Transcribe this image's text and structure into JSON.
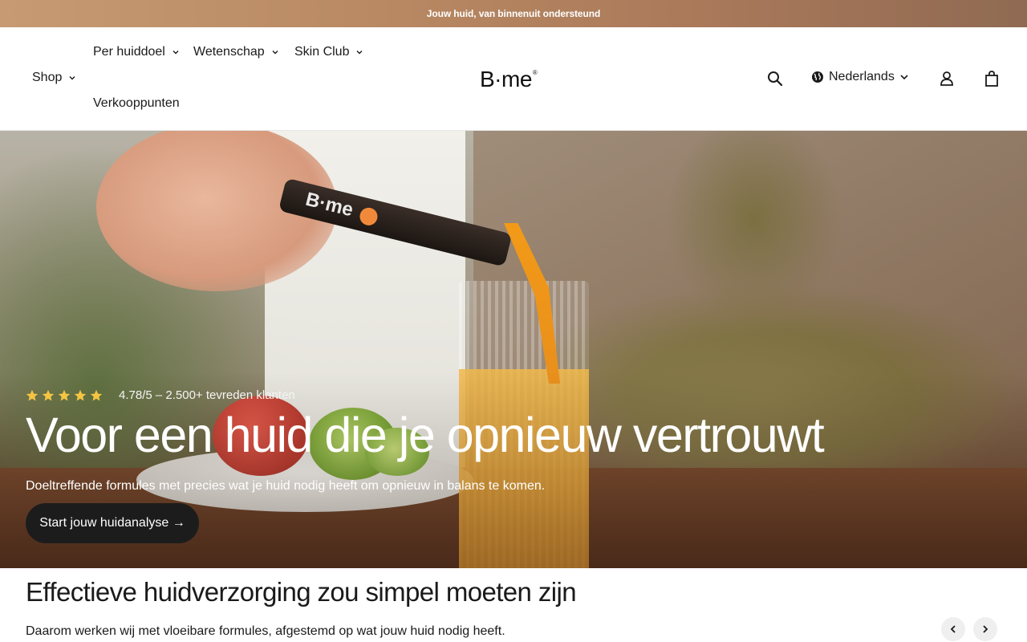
{
  "announcement": {
    "text": "Jouw huid, van binnenuit ondersteund"
  },
  "nav": {
    "shop": "Shop",
    "per_huiddoel": "Per huiddoel",
    "wetenschap": "Wetenschap",
    "skin_club": "Skin Club",
    "verkooppunten": "Verkooppunten"
  },
  "logo": {
    "text": "B·me",
    "reg": "®"
  },
  "header": {
    "language": "Nederlands"
  },
  "hero": {
    "vial_brand": "B·me",
    "rating_value": 5,
    "rating_text": "4.78/5 – 2.500+ tevreden klanten",
    "title": "Voor een huid die je opnieuw vertrouwt",
    "subtitle": "Doeltreffende formules met precies wat je huid nodig heeft om opnieuw in balans te komen.",
    "cta": "Start jouw huidanalyse →"
  },
  "section": {
    "title": "Effectieve huidverzorging zou simpel moeten zijn",
    "text": "Daarom werken wij met vloeibare formules, afgestemd op wat jouw huid nodig heeft."
  },
  "colors": {
    "accent": "#1c1c1c",
    "announce_bg": "#b98a63",
    "star": "#f5c542"
  },
  "icons": [
    "search-icon",
    "globe-icon",
    "chevron-down-icon",
    "user-icon",
    "bag-icon",
    "star-icon",
    "chevron-left-icon",
    "chevron-right-icon"
  ]
}
